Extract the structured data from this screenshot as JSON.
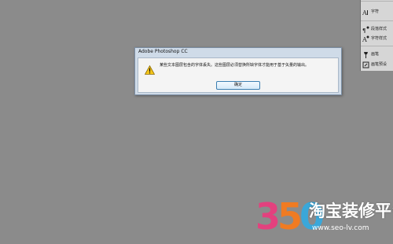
{
  "app": {
    "background_color": "#8b8b8b"
  },
  "side_panel": {
    "items": [
      {
        "label": "字符",
        "icon": "type-icon"
      },
      {
        "label": "段落样式",
        "icon": "paragraph-style-icon"
      },
      {
        "label": "字符样式",
        "icon": "character-style-icon"
      },
      {
        "label": "画笔",
        "icon": "brush-icon"
      },
      {
        "label": "画笔预设",
        "icon": "brush-preset-icon"
      }
    ]
  },
  "dialog": {
    "title": "Adobe Photoshop CC",
    "icon": "warning-icon",
    "message": "某些文本图层包含的字体丢失。这些图层必须替换所缺字体才能用于基于矢量的输出。",
    "ok_label": "确定"
  },
  "watermark": {
    "digits": "350",
    "name": "淘宝装修平台",
    "url": "www.seo-lv.com"
  }
}
